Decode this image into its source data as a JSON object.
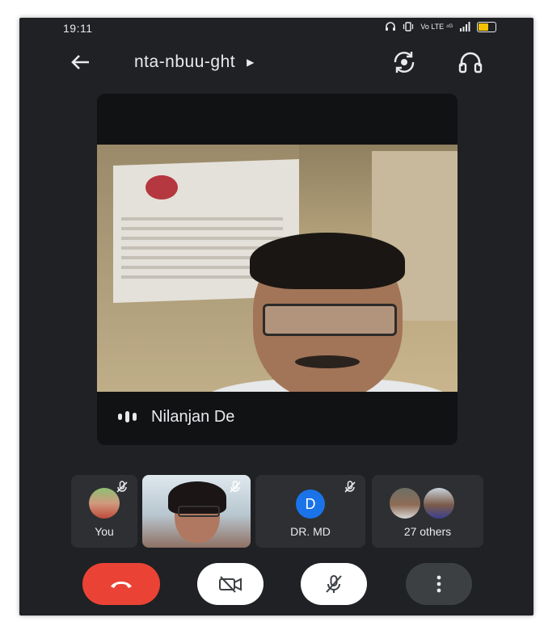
{
  "status_bar": {
    "time": "19:11",
    "network_text": "Vo LTE ⁴ᴳ",
    "icons": [
      "headset-icon",
      "vibrate-icon",
      "volte-icon",
      "signal-icon",
      "battery-icon"
    ],
    "battery_color": "#f2c200"
  },
  "top_bar": {
    "back_icon": "arrow-left-icon",
    "meeting_code": "nta-nbuu-ght",
    "expand_icon": "caret-right-icon",
    "switch_camera_icon": "switch-camera-icon",
    "audio_output_icon": "headphones-icon"
  },
  "main_speaker": {
    "name": "Nilanjan De",
    "speaking_indicator_icon": "audio-bars-icon"
  },
  "participants": [
    {
      "label": "You",
      "type": "photo-avatar",
      "muted": true
    },
    {
      "label": "",
      "type": "video",
      "muted": true
    },
    {
      "label": "DR. MD",
      "type": "letter-avatar",
      "letter": "D",
      "avatar_color": "#1a73e8",
      "muted": true
    },
    {
      "label": "27 others",
      "type": "group",
      "muted": false
    }
  ],
  "controls": {
    "end_call_icon": "phone-hangup-icon",
    "end_call_color": "#ea4335",
    "camera_icon": "video-off-icon",
    "mic_icon": "mic-off-icon",
    "more_icon": "more-vertical-icon"
  }
}
